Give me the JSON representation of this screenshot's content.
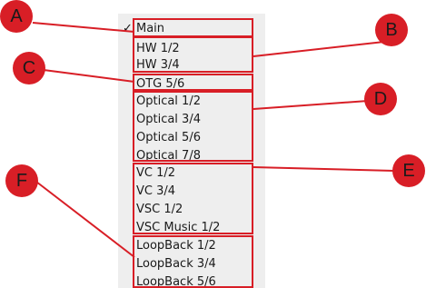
{
  "menu": {
    "selected_mark": "✓",
    "items": [
      {
        "label": "Main",
        "checked": true
      },
      {
        "label": "HW 1/2",
        "checked": false
      },
      {
        "label": "HW 3/4",
        "checked": false
      },
      {
        "label": "OTG 5/6",
        "checked": false
      },
      {
        "label": "Optical 1/2",
        "checked": false
      },
      {
        "label": "Optical 3/4",
        "checked": false
      },
      {
        "label": "Optical 5/6",
        "checked": false
      },
      {
        "label": "Optical 7/8",
        "checked": false
      },
      {
        "label": "VC 1/2",
        "checked": false
      },
      {
        "label": "VC 3/4",
        "checked": false
      },
      {
        "label": "VSC 1/2",
        "checked": false
      },
      {
        "label": "VSC Music 1/2",
        "checked": false
      },
      {
        "label": "LoopBack 1/2",
        "checked": false
      },
      {
        "label": "LoopBack 3/4",
        "checked": false
      },
      {
        "label": "LoopBack 5/6",
        "checked": false
      }
    ]
  },
  "annotations": {
    "markers": [
      "A",
      "B",
      "C",
      "D",
      "E",
      "F"
    ],
    "color": "#d81e26"
  }
}
